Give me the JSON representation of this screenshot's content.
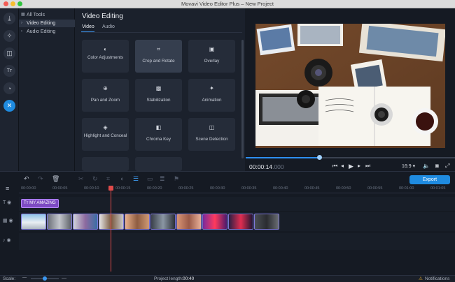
{
  "window": {
    "title": "Movavi Video Editor Plus – New Project"
  },
  "categories": [
    {
      "label": "All Tools",
      "icon": "grid-icon"
    },
    {
      "label": "Video Editing",
      "icon": "chevron-right-icon"
    },
    {
      "label": "Audio Editing",
      "icon": "chevron-right-icon"
    }
  ],
  "fx": {
    "title": "Video Editing",
    "tabs": [
      "Video",
      "Audio"
    ],
    "cards": [
      {
        "label": "Color Adjustments",
        "icon": "◐",
        "name": "color-adjustments-icon"
      },
      {
        "label": "Crop and Rotate",
        "icon": "⌗",
        "name": "crop-rotate-icon"
      },
      {
        "label": "Overlay",
        "icon": "▣",
        "name": "overlay-icon"
      },
      {
        "label": "Pan and Zoom",
        "icon": "⊕",
        "name": "pan-zoom-icon"
      },
      {
        "label": "Stabilization",
        "icon": "▩",
        "name": "stabilization-icon"
      },
      {
        "label": "Animation",
        "icon": "✦",
        "name": "animation-icon"
      },
      {
        "label": "Highlight and Conceal",
        "icon": "◈",
        "name": "highlight-conceal-icon"
      },
      {
        "label": "Chroma Key",
        "icon": "◧",
        "name": "chroma-key-icon"
      },
      {
        "label": "Scene Detection",
        "icon": "◫",
        "name": "scene-detection-icon"
      }
    ]
  },
  "player": {
    "timecode": "00:00:14",
    "timecode_ms": ".000",
    "progress": 0.35,
    "aspect": "16:9 ▾"
  },
  "timeline": {
    "export_label": "Export",
    "ruler": [
      "00:00:00",
      "00:00:05",
      "00:00:10",
      "00:00:15",
      "00:00:20",
      "00:00:25",
      "00:00:30",
      "00:00:35",
      "00:00:40",
      "00:00:45",
      "00:00:50",
      "00:00:55",
      "00:01:00",
      "00:01:05"
    ],
    "title_clip": "MY AMAZING"
  },
  "status": {
    "scale_label": "Scale:",
    "project_length_label": "Project length:",
    "project_length": "00:40",
    "notifications": "Notifications"
  },
  "colors": {
    "accent": "#1f8be0",
    "title_clip": "#7d4bc2",
    "playhead": "#e04a4a"
  }
}
